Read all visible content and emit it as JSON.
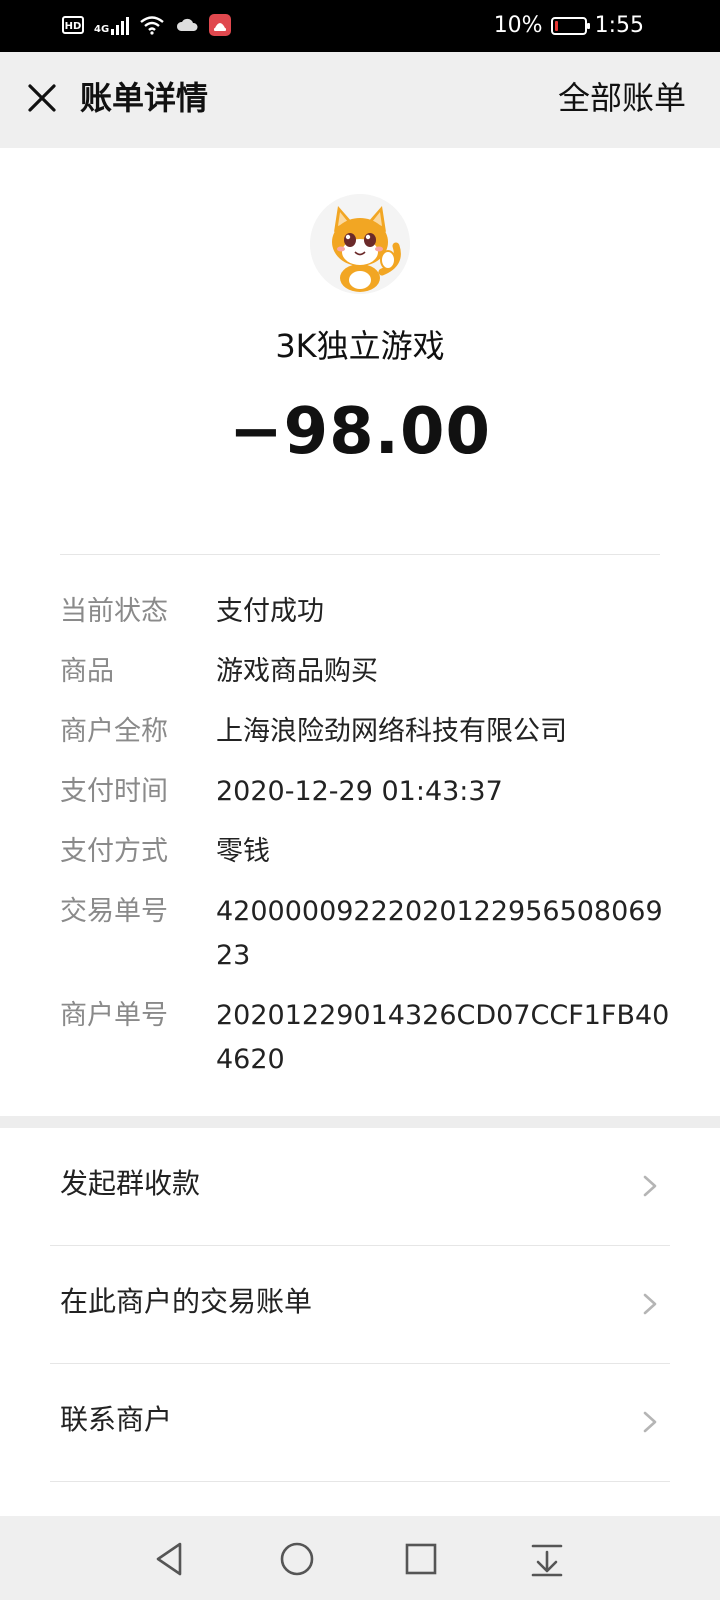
{
  "status_bar": {
    "hd": "HD",
    "network": "4G",
    "battery_percent": "10%",
    "battery_level": 0.1,
    "time": "1:55",
    "icons": [
      "hd-icon",
      "signal-icon",
      "wifi-icon",
      "cloud-icon",
      "app-notification-icon",
      "battery-icon"
    ]
  },
  "nav": {
    "close_icon": "close-icon",
    "title": "账单详情",
    "action": "全部账单"
  },
  "bill": {
    "avatar_icon": "cat-mascot-avatar",
    "merchant_name": "3K独立游戏",
    "amount": "−98.00",
    "details": [
      {
        "label": "当前状态",
        "value": "支付成功"
      },
      {
        "label": "商品",
        "value": "游戏商品购买"
      },
      {
        "label": "商户全称",
        "value": "上海浪险劲网络科技有限公司"
      },
      {
        "label": "支付时间",
        "value": "2020-12-29 01:43:37"
      },
      {
        "label": "支付方式",
        "value": "零钱"
      },
      {
        "label": "交易单号",
        "value": "4200000922202012295650806923"
      },
      {
        "label": "商户单号",
        "value": "20201229014326CD07CCF1FB404620"
      }
    ]
  },
  "menu": {
    "items": [
      {
        "label": "发起群收款"
      },
      {
        "label": "在此商户的交易账单"
      },
      {
        "label": "联系商户"
      }
    ]
  },
  "system_nav": {
    "buttons": [
      "back-icon",
      "home-icon",
      "recents-icon",
      "notification-pulldown-icon"
    ]
  },
  "colors": {
    "status_bar_bg": "#000000",
    "nav_bg": "#efefef",
    "card_bg": "#ffffff",
    "label_gray": "#8a8a8a",
    "battery_low": "#e53935"
  }
}
